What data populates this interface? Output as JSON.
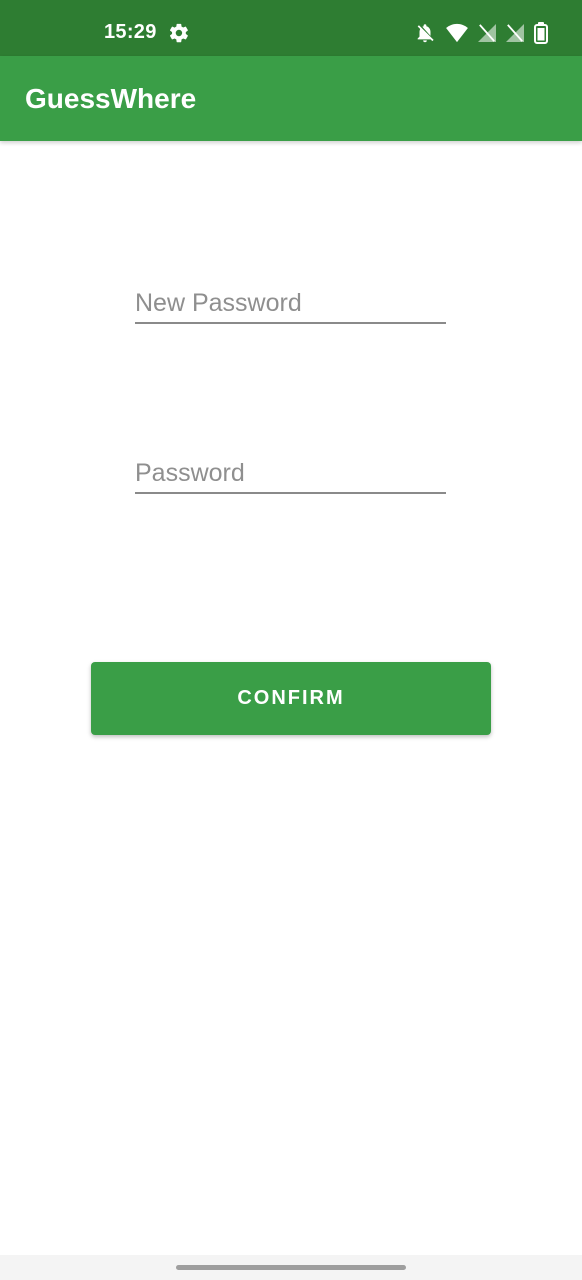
{
  "status_bar": {
    "time": "15:29",
    "icons": [
      "gear-icon",
      "bell-off-icon",
      "wifi-icon",
      "no-signal-icon",
      "no-signal-icon",
      "battery-icon"
    ]
  },
  "app_bar": {
    "title": "GuessWhere"
  },
  "form": {
    "new_password": {
      "placeholder": "New Password",
      "value": ""
    },
    "password": {
      "placeholder": "Password",
      "value": ""
    },
    "confirm_label": "CONFIRM"
  },
  "colors": {
    "status_bar": "#2e7d32",
    "primary": "#3a9e47",
    "text_on_primary": "#ffffff",
    "placeholder": "#8f8f8f"
  }
}
